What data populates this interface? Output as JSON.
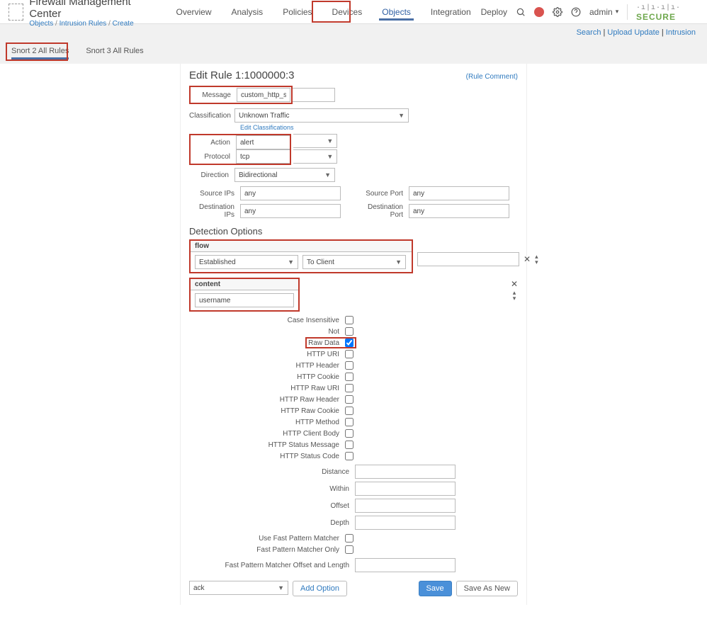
{
  "header": {
    "app_title": "Firewall Management Center",
    "breadcrumb": {
      "a": "Objects",
      "b": "Intrusion Rules",
      "c": "Create"
    },
    "nav": [
      "Overview",
      "Analysis",
      "Policies",
      "Devices",
      "Objects",
      "Integration"
    ],
    "active_nav": "Objects",
    "deploy": "Deploy",
    "admin": "admin",
    "brand1": "cisco",
    "brand2": "SECURE"
  },
  "linksbar": [
    "Search",
    "Upload Update",
    "Intrusion"
  ],
  "tabs": {
    "items": [
      "Snort 2 All Rules",
      "Snort 3 All Rules"
    ],
    "active": "Snort 2 All Rules"
  },
  "edit": {
    "title": "Edit Rule 1:1000000:3",
    "rule_comment": "(Rule Comment)",
    "labels": {
      "message": "Message",
      "classification": "Classification",
      "action": "Action",
      "protocol": "Protocol",
      "direction": "Direction",
      "src_ips": "Source IPs",
      "src_port": "Source Port",
      "dst_ips": "Destination IPs",
      "dst_port": "Destination Port"
    },
    "values": {
      "message": "custom_http_sig",
      "classification": "Unknown Traffic",
      "action": "alert",
      "protocol": "tcp",
      "direction": "Bidirectional",
      "src_ips": "any",
      "src_port": "any",
      "dst_ips": "any",
      "dst_port": "any"
    },
    "edit_class_link": "Edit Classifications",
    "detection_heading": "Detection Options",
    "flow": {
      "name": "flow",
      "v1": "Established",
      "v2": "To Client"
    },
    "content": {
      "name": "content",
      "value": "username"
    },
    "checkboxes": [
      {
        "label": "Case Insensitive",
        "checked": false
      },
      {
        "label": "Not",
        "checked": false
      },
      {
        "label": "Raw Data",
        "checked": true,
        "highlight": true
      },
      {
        "label": "HTTP URI",
        "checked": false
      },
      {
        "label": "HTTP Header",
        "checked": false
      },
      {
        "label": "HTTP Cookie",
        "checked": false
      },
      {
        "label": "HTTP Raw URI",
        "checked": false
      },
      {
        "label": "HTTP Raw Header",
        "checked": false
      },
      {
        "label": "HTTP Raw Cookie",
        "checked": false
      },
      {
        "label": "HTTP Method",
        "checked": false
      },
      {
        "label": "HTTP Client Body",
        "checked": false
      },
      {
        "label": "HTTP Status Message",
        "checked": false
      },
      {
        "label": "HTTP Status Code",
        "checked": false
      }
    ],
    "dist_labels": [
      "Distance",
      "Within",
      "Offset",
      "Depth"
    ],
    "fpm_checks": [
      "Use Fast Pattern Matcher",
      "Fast Pattern Matcher Only"
    ],
    "fpm_offset_label": "Fast Pattern Matcher Offset and Length",
    "footer": {
      "select_val": "ack",
      "add_option": "Add Option",
      "save": "Save",
      "save_as_new": "Save As New"
    }
  }
}
